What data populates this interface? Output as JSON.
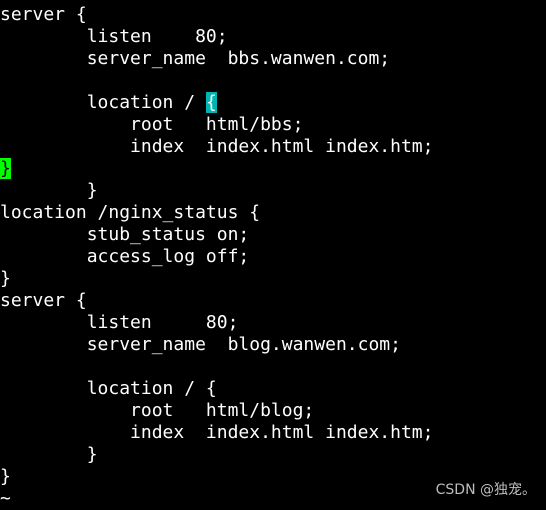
{
  "editor": {
    "lines": [
      [
        {
          "text": "server {"
        }
      ],
      [
        {
          "text": "        listen    80;"
        }
      ],
      [
        {
          "text": "        server_name  bbs.wanwen.com;"
        }
      ],
      [
        {
          "text": ""
        }
      ],
      [
        {
          "text": "        location / "
        },
        {
          "text": "{",
          "hl": "cursor"
        }
      ],
      [
        {
          "text": "            root   html/bbs;"
        }
      ],
      [
        {
          "text": "            index  index.html index.htm;"
        }
      ],
      [
        {
          "text": "}",
          "hl": "match"
        }
      ],
      [
        {
          "text": "        }"
        }
      ],
      [
        {
          "text": "location /nginx_status {"
        }
      ],
      [
        {
          "text": "        stub_status on;"
        }
      ],
      [
        {
          "text": "        access_log off;"
        }
      ],
      [
        {
          "text": "}"
        }
      ],
      [
        {
          "text": "server {"
        }
      ],
      [
        {
          "text": "        listen     80;"
        }
      ],
      [
        {
          "text": "        server_name  blog.wanwen.com;"
        }
      ],
      [
        {
          "text": ""
        }
      ],
      [
        {
          "text": "        location / {"
        }
      ],
      [
        {
          "text": "            root   html/blog;"
        }
      ],
      [
        {
          "text": "            index  index.html index.htm;"
        }
      ],
      [
        {
          "text": "        }"
        }
      ],
      [
        {
          "text": "}"
        }
      ],
      [
        {
          "text": "~",
          "hl": "tilde"
        }
      ]
    ],
    "colors": {
      "cursor": "#00b4b4",
      "match": "#00ff00",
      "tilde": "#4a6cff",
      "background": "#000000",
      "text": "#ffffff"
    }
  },
  "watermark": "CSDN @独宠。"
}
